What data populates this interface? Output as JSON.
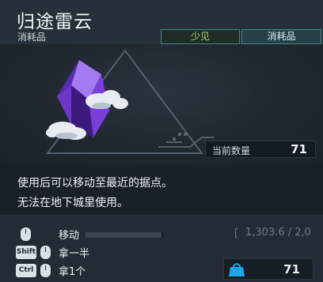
{
  "item": {
    "name": "归途雷云",
    "type": "消耗品",
    "rarity_tag": "少见",
    "category_tag": "消耗品",
    "quantity_label": "当前数量",
    "quantity_value": "71",
    "description_lines": [
      "使用后可以移动至最近的据点。",
      "无法在地下城里使用。"
    ]
  },
  "controls": [
    {
      "key": "",
      "icon": "mouse-icon",
      "label": "移动"
    },
    {
      "key": "Shift",
      "icon": "mouse-icon",
      "label": "拿一半"
    },
    {
      "key": "Ctrl",
      "icon": "mouse-icon",
      "label": "拿1个"
    }
  ],
  "weight_text": "1,303.6 / 2,0",
  "bag": {
    "icon": "bag-icon",
    "value": "71"
  },
  "colors": {
    "rarity": "#9fd86c",
    "accent_border": "#3f8a86",
    "bag_icon": "#1aa6e8",
    "crystal": "#7a3fd6"
  }
}
